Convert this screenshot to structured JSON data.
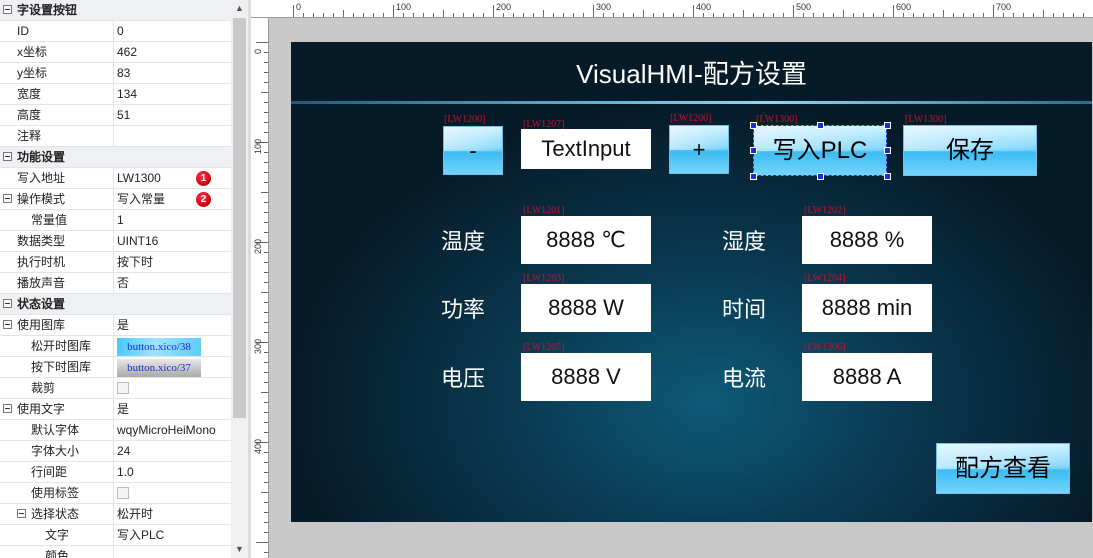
{
  "panel": {
    "rows": [
      {
        "type": "section",
        "key": "字设置按钮"
      },
      {
        "type": "prop",
        "key": "ID",
        "value": "0"
      },
      {
        "type": "prop",
        "key": "x坐标",
        "value": "462"
      },
      {
        "type": "prop",
        "key": "y坐标",
        "value": "83"
      },
      {
        "type": "prop",
        "key": "宽度",
        "value": "134"
      },
      {
        "type": "prop",
        "key": "高度",
        "value": "51"
      },
      {
        "type": "prop",
        "key": "注释",
        "value": ""
      },
      {
        "type": "section",
        "key": "功能设置"
      },
      {
        "type": "prop",
        "key": "写入地址",
        "value": "LW1300",
        "badge": "1"
      },
      {
        "type": "prop",
        "key": "操作模式",
        "value": "写入常量",
        "badge": "2",
        "toggle": true
      },
      {
        "type": "prop",
        "key": "常量值",
        "value": "1",
        "indent": 2
      },
      {
        "type": "prop",
        "key": "数据类型",
        "value": "UINT16"
      },
      {
        "type": "prop",
        "key": "执行时机",
        "value": "按下时"
      },
      {
        "type": "prop",
        "key": "播放声音",
        "value": "否"
      },
      {
        "type": "section",
        "key": "状态设置"
      },
      {
        "type": "prop",
        "key": "使用图库",
        "value": "是",
        "toggle": true
      },
      {
        "type": "image",
        "key": "松开时图库",
        "value": "button.xico/38",
        "style": "a",
        "indent": 2
      },
      {
        "type": "image",
        "key": "按下时图库",
        "value": "button.xico/37",
        "style": "b",
        "indent": 2
      },
      {
        "type": "check",
        "key": "裁剪",
        "indent": 2
      },
      {
        "type": "prop",
        "key": "使用文字",
        "value": "是",
        "toggle": true
      },
      {
        "type": "prop",
        "key": "默认字体",
        "value": "wqyMicroHeiMono",
        "indent": 2
      },
      {
        "type": "prop",
        "key": "字体大小",
        "value": "24",
        "indent": 2
      },
      {
        "type": "prop",
        "key": "行间距",
        "value": "1.0",
        "indent": 2
      },
      {
        "type": "check",
        "key": "使用标签",
        "indent": 2
      },
      {
        "type": "prop",
        "key": "选择状态",
        "value": "松开时",
        "toggle": true,
        "indent": 1
      },
      {
        "type": "prop",
        "key": "文字",
        "value": "写入PLC",
        "indent": 3
      },
      {
        "type": "swatch",
        "key": "颜色",
        "indent": 3
      }
    ]
  },
  "rulers": {
    "h_labels": [
      "0",
      "100",
      "200",
      "300",
      "400",
      "500",
      "600",
      "700"
    ],
    "v_labels": [
      "0",
      "100",
      "200",
      "300",
      "400"
    ]
  },
  "screen": {
    "title": "VisualHMI-配方设置",
    "minus_button": {
      "label": "-",
      "tag": "[LW1200]"
    },
    "text_input": {
      "value": "TextInput",
      "tag": "[LW1207]"
    },
    "plus_button": {
      "label": "+",
      "tag": "[LW1200]"
    },
    "write_plc_button": {
      "label": "写入PLC",
      "tag": "[LW1300]"
    },
    "save_button": {
      "label": "保存",
      "tag": "[LW1300]"
    },
    "fields": [
      {
        "label": "温度",
        "value": "8888 ℃",
        "tag": "[LW1201]"
      },
      {
        "label": "湿度",
        "value": "8888 %",
        "tag": "[LW1202]"
      },
      {
        "label": "功率",
        "value": "8888 W",
        "tag": "[LW1203]"
      },
      {
        "label": "时间",
        "value": "8888 min",
        "tag": "[LW1204]"
      },
      {
        "label": "电压",
        "value": "8888 V",
        "tag": "[LW1205]"
      },
      {
        "label": "电流",
        "value": "8888 A",
        "tag": "[LW1206]"
      }
    ],
    "view_recipe_button": {
      "label": "配方查看"
    }
  }
}
